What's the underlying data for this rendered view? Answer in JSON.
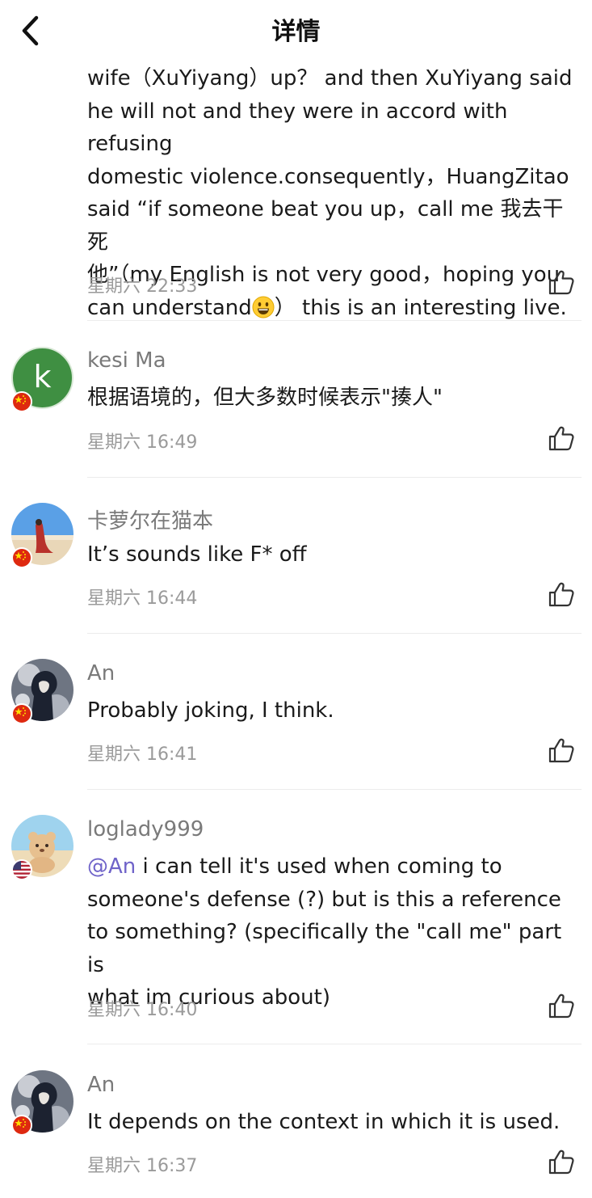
{
  "header": {
    "title": "详情"
  },
  "icons": {
    "back": "chevron-left-icon",
    "like": "thumbs-up-icon",
    "emoji": "grinning-face-emoji"
  },
  "colors": {
    "mention": "#6f63c9",
    "meta": "#9a9a9a",
    "username": "#7a7a7a",
    "kesi_avatar": "#3f8f42"
  },
  "top_comment": {
    "lines": [
      "wife（XuYiyang）up？ and then XuYiyang said",
      "he will not and they were in accord with refusing",
      "domestic violence.consequently，HuangZitao",
      "said “if someone beat you up，call me 我去干死",
      "他”（my English is not very good，hoping you"
    ],
    "last_line_before_emoji": "can understand",
    "last_line_after_emoji": "） this is an interesting live.",
    "time": "星期六 22:33"
  },
  "comments": [
    {
      "username": "kesi Ma",
      "avatar_letter": "k",
      "flag": "cn",
      "text": "根据语境的，但大多数时候表示\"揍人\"",
      "time": "星期六 16:49"
    },
    {
      "username": "卡萝尔在猫本",
      "flag": "cn",
      "text": "It’s sounds like F* off",
      "time": "星期六 16:44"
    },
    {
      "username": "An",
      "flag": "cn",
      "text": "Probably joking, I think.",
      "time": "星期六 16:41"
    },
    {
      "username": "loglady999",
      "flag": "us",
      "mention": "@An",
      "lines": [
        " i can tell it's used when coming to",
        "someone's defense (?) but is this a reference",
        "to something? (specifically the \"call me\" part is",
        "what im curious about)"
      ],
      "time": "星期六 16:40"
    },
    {
      "username": "An",
      "flag": "cn",
      "text": "It depends on the context in which it is used.",
      "time": "星期六 16:37"
    }
  ]
}
